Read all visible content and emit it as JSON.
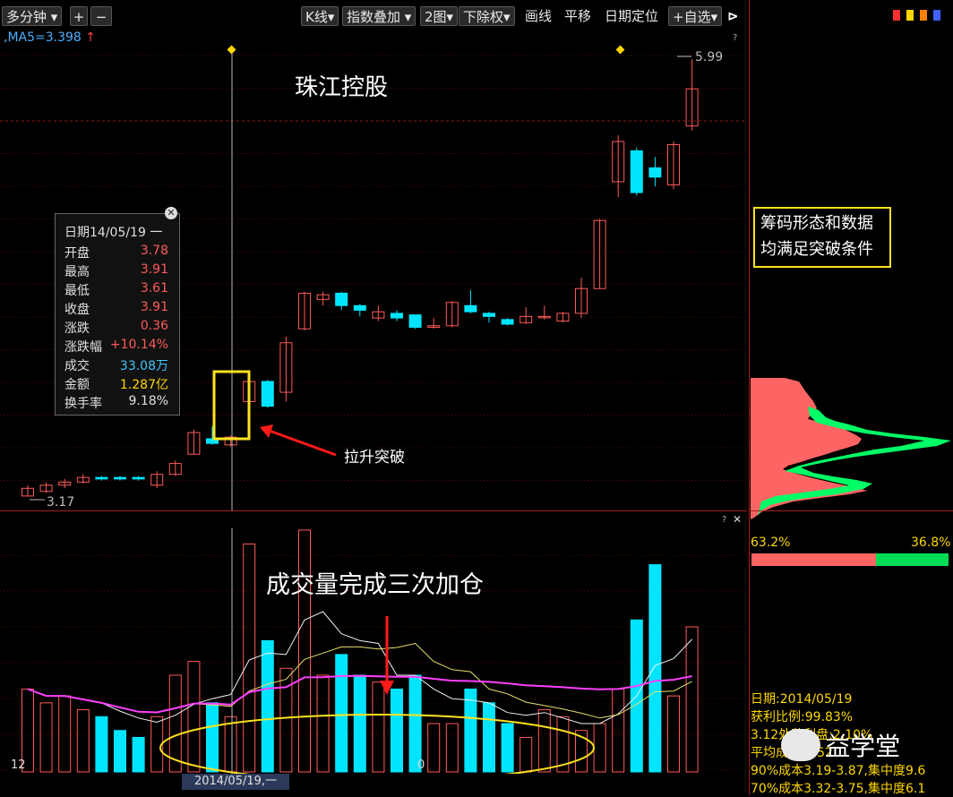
{
  "toolbar": {
    "period": "多分钟",
    "zoom_in": "+",
    "zoom_out": "−",
    "kline": "K线",
    "index_overlay": "指数叠加",
    "two_chart": "2图",
    "ex_rights": "下除权",
    "draw": "画线",
    "pan": "平移",
    "date_locate": "日期定位",
    "self_select": "+自选",
    "close": "ꟷ"
  },
  "ma": {
    "label": ",MA5=3.398",
    "arrow": "↑"
  },
  "chart": {
    "stock_name": "珠江控股",
    "high_label": "5.99",
    "low_label": "3.17",
    "breakout_note": "拉升突破",
    "volume_note": "成交量完成三次加仓",
    "vol_left_label": "12",
    "vol_mid_label": "0",
    "bottom_date": "2014/05/19,一",
    "question": "?"
  },
  "tooltip": {
    "date": "日期14/05/19 一",
    "rows": [
      {
        "label": "开盘",
        "value": "3.78"
      },
      {
        "label": "最高",
        "value": "3.91"
      },
      {
        "label": "最低",
        "value": "3.61"
      },
      {
        "label": "收盘",
        "value": "3.91"
      },
      {
        "label": "涨跌",
        "value": "0.36"
      },
      {
        "label": "涨跌幅",
        "value": "+10.14%"
      },
      {
        "label": "成交",
        "value": "33.08万"
      },
      {
        "label": "金额",
        "value": "1.287亿"
      },
      {
        "label": "换手率",
        "value": "9.18%"
      }
    ]
  },
  "chip_panel": {
    "note_line1": "筹码形态和数据",
    "note_line2": "均满足突破条件",
    "profit_pct": "63.2%",
    "loss_pct": "36.8%",
    "profit_ratio": 0.632,
    "date": "日期:2014/05/19",
    "win_ratio": "获利比例:99.83%",
    "line3": "3.12处获利盘:2.10%",
    "line4": "平均成本:3.52",
    "line5": "90%成本3.19-3.87,集中度9.6",
    "line6": "70%成本3.32-3.75,集中度6.1",
    "watermark": "益学堂"
  },
  "colors": {
    "up": "#ff5a5a",
    "down": "#00e5ff",
    "chip_profit": "#ff6464",
    "chip_loss": "#00ff66",
    "highlight": "#ffe21f"
  },
  "chart_data": {
    "type": "candlestick",
    "title": "珠江控股",
    "candles": [
      {
        "o": 3.17,
        "c": 3.22,
        "h": 3.24,
        "l": 3.17
      },
      {
        "o": 3.2,
        "c": 3.24,
        "h": 3.26,
        "l": 3.19
      },
      {
        "o": 3.24,
        "c": 3.26,
        "h": 3.28,
        "l": 3.22
      },
      {
        "o": 3.26,
        "c": 3.29,
        "h": 3.31,
        "l": 3.25
      },
      {
        "o": 3.29,
        "c": 3.28,
        "h": 3.3,
        "l": 3.27
      },
      {
        "o": 3.29,
        "c": 3.28,
        "h": 3.3,
        "l": 3.27
      },
      {
        "o": 3.29,
        "c": 3.28,
        "h": 3.3,
        "l": 3.27
      },
      {
        "o": 3.24,
        "c": 3.31,
        "h": 3.33,
        "l": 3.22
      },
      {
        "o": 3.31,
        "c": 3.38,
        "h": 3.4,
        "l": 3.3
      },
      {
        "o": 3.44,
        "c": 3.58,
        "h": 3.6,
        "l": 3.44
      },
      {
        "o": 3.54,
        "c": 3.51,
        "h": 3.62,
        "l": 3.5
      },
      {
        "o": 3.5,
        "c": 3.55,
        "h": 3.56,
        "l": 3.49
      },
      {
        "o": 3.78,
        "c": 3.91,
        "h": 3.91,
        "l": 3.61
      },
      {
        "o": 3.91,
        "c": 3.75,
        "h": 3.92,
        "l": 3.74
      },
      {
        "o": 3.84,
        "c": 4.16,
        "h": 4.2,
        "l": 3.78
      },
      {
        "o": 4.25,
        "c": 4.48,
        "h": 4.49,
        "l": 4.24
      },
      {
        "o": 4.44,
        "c": 4.47,
        "h": 4.49,
        "l": 4.4
      },
      {
        "o": 4.48,
        "c": 4.4,
        "h": 4.49,
        "l": 4.37
      },
      {
        "o": 4.4,
        "c": 4.37,
        "h": 4.41,
        "l": 4.33
      },
      {
        "o": 4.32,
        "c": 4.36,
        "h": 4.4,
        "l": 4.3
      },
      {
        "o": 4.35,
        "c": 4.32,
        "h": 4.37,
        "l": 4.3
      },
      {
        "o": 4.34,
        "c": 4.26,
        "h": 4.34,
        "l": 4.25
      },
      {
        "o": 4.26,
        "c": 4.27,
        "h": 4.32,
        "l": 4.25
      },
      {
        "o": 4.27,
        "c": 4.42,
        "h": 4.43,
        "l": 4.26
      },
      {
        "o": 4.4,
        "c": 4.36,
        "h": 4.5,
        "l": 4.35
      },
      {
        "o": 4.35,
        "c": 4.33,
        "h": 4.36,
        "l": 4.29
      },
      {
        "o": 4.31,
        "c": 4.28,
        "h": 4.32,
        "l": 4.27
      },
      {
        "o": 4.29,
        "c": 4.33,
        "h": 4.39,
        "l": 4.28
      },
      {
        "o": 4.33,
        "c": 4.33,
        "h": 4.4,
        "l": 4.31
      },
      {
        "o": 4.3,
        "c": 4.35,
        "h": 4.36,
        "l": 4.29
      },
      {
        "o": 4.35,
        "c": 4.51,
        "h": 4.58,
        "l": 4.32
      },
      {
        "o": 4.51,
        "c": 4.95,
        "h": 4.96,
        "l": 4.51
      },
      {
        "o": 5.2,
        "c": 5.46,
        "h": 5.5,
        "l": 5.1
      },
      {
        "o": 5.4,
        "c": 5.13,
        "h": 5.42,
        "l": 5.11
      },
      {
        "o": 5.29,
        "c": 5.23,
        "h": 5.36,
        "l": 5.17
      },
      {
        "o": 5.18,
        "c": 5.44,
        "h": 5.46,
        "l": 5.15
      },
      {
        "o": 5.56,
        "c": 5.8,
        "h": 5.99,
        "l": 5.53
      }
    ],
    "volume": [
      12,
      10,
      11,
      9,
      8,
      6,
      5,
      8,
      14,
      16,
      10,
      8,
      33,
      19,
      15,
      35,
      14,
      17,
      14,
      13,
      12,
      14,
      7,
      7,
      12,
      10,
      7,
      5,
      9,
      8,
      6,
      7,
      12,
      22,
      30,
      11,
      21
    ],
    "ylim": [
      3.1,
      6.05
    ],
    "vol_max": 35
  }
}
